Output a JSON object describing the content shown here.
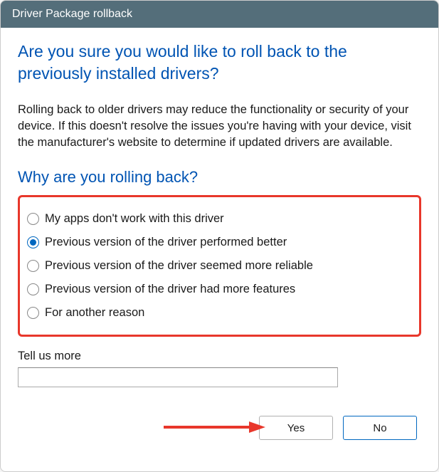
{
  "titlebar": {
    "title": "Driver Package rollback"
  },
  "heading": "Are you sure you would like to roll back to the previously installed drivers?",
  "body_text": "Rolling back to older drivers may reduce the functionality or security of your device.  If this doesn't resolve the issues you're having with your device, visit the manufacturer's website to determine if updated drivers are available.",
  "subheading": "Why are you rolling back?",
  "reasons": [
    {
      "label": "My apps don't work with this driver",
      "selected": false
    },
    {
      "label": "Previous version of the driver performed better",
      "selected": true
    },
    {
      "label": "Previous version of the driver seemed more reliable",
      "selected": false
    },
    {
      "label": "Previous version of the driver had more features",
      "selected": false
    },
    {
      "label": "For another reason",
      "selected": false
    }
  ],
  "tell_more": {
    "label": "Tell us more",
    "value": ""
  },
  "buttons": {
    "yes": "Yes",
    "no": "No"
  },
  "annotation": {
    "highlight_color": "#e8372b",
    "arrow_color": "#e8372b"
  }
}
